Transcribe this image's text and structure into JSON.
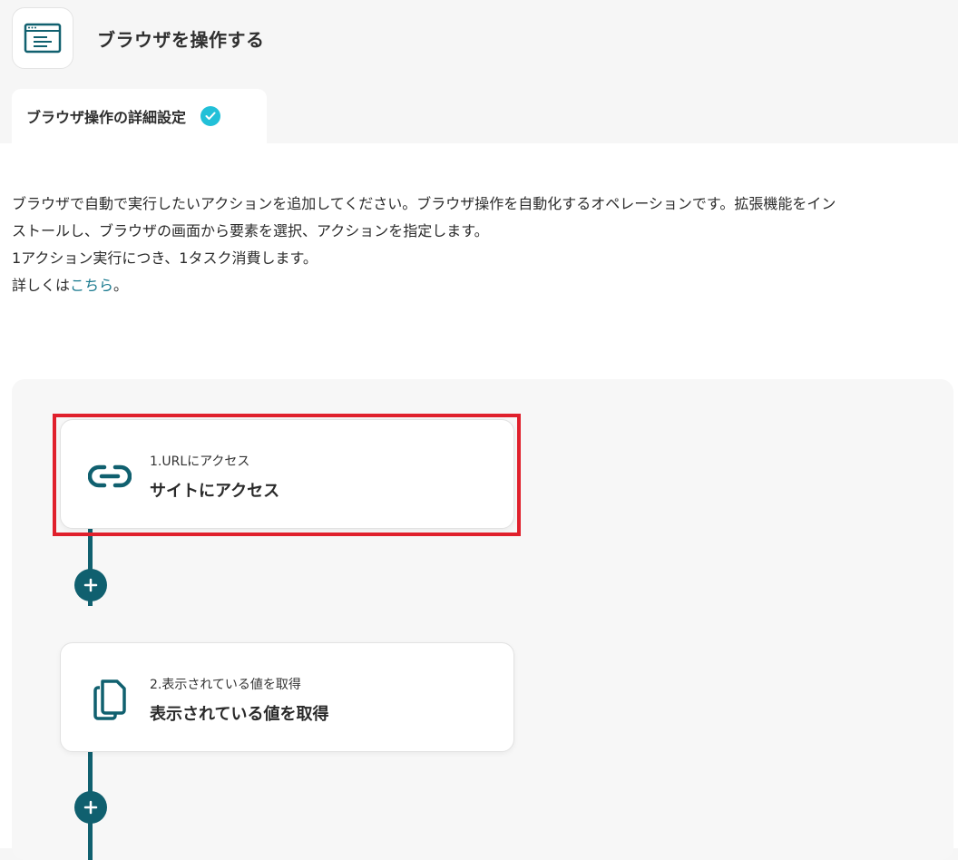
{
  "header": {
    "title": "ブラウザを操作する",
    "icon": "browser-window-icon"
  },
  "tabs": [
    {
      "label": "ブラウザ操作の詳細設定",
      "status": "completed",
      "icon": "check-circle-icon"
    }
  ],
  "description": {
    "line1": "ブラウザで自動で実行したいアクションを追加してください。ブラウザ操作を自動化するオペレーションです。拡張機能をイン",
    "line2": "ストールし、ブラウザの画面から要素を選択、アクションを指定します。",
    "line3": "1アクション実行につき、1タスク消費します。",
    "line4_prefix": "詳しくは",
    "line4_link": "こちら",
    "line4_suffix": "。"
  },
  "flow": {
    "steps": [
      {
        "number_label": "1.URLにアクセス",
        "title": "サイトにアクセス",
        "icon": "link-icon",
        "highlighted": true
      },
      {
        "number_label": "2.表示されている値を取得",
        "title": "表示されている値を取得",
        "icon": "copy-icon",
        "highlighted": false
      }
    ]
  },
  "colors": {
    "accent": "#10606f",
    "check": "#22c0d8",
    "highlight": "#e0202c",
    "link": "#1a7a8f"
  }
}
